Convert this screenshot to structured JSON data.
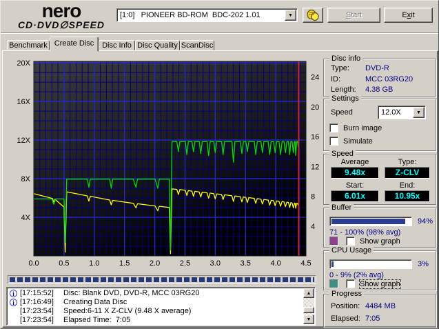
{
  "icons": {
    "info": "i",
    "dropdown": "▼",
    "scroll_up": "▲",
    "scroll_down": "▼"
  },
  "header": {
    "logo_top": "nero",
    "logo_bottom": "CD·DVD∅SPEED",
    "drive_selector": "[1:0]   PIONEER BD-ROM  BDC-202 1.01",
    "start_button": {
      "pre": "",
      "key": "S",
      "post": "tart"
    },
    "exit_button": {
      "pre": "E",
      "key": "x",
      "post": "it"
    }
  },
  "tabs": [
    {
      "label": "Benchmark"
    },
    {
      "label": "Create Disc"
    },
    {
      "label": "Disc Info"
    },
    {
      "label": "Disc Quality"
    },
    {
      "label": "ScanDisc"
    }
  ],
  "active_tab": "Create Disc",
  "disc_info": {
    "title": "Disc info",
    "rows": [
      {
        "label": "Type:",
        "value": "DVD-R"
      },
      {
        "label": "ID:",
        "value": "MCC 03RG20"
      },
      {
        "label": "Length:",
        "value": "4.38 GB"
      }
    ]
  },
  "settings": {
    "title": "Settings",
    "speed_label": "Speed",
    "speed_value": "12.0X",
    "checkboxes": [
      {
        "label": "Burn image",
        "checked": false
      },
      {
        "label": "Simulate",
        "checked": false
      }
    ]
  },
  "speed_panel": {
    "title": "Speed",
    "average_label": "Average",
    "average_value": "9.48x",
    "type_label": "Type:",
    "type_value": "Z-CLV",
    "start_label": "Start:",
    "start_value": "6.01x",
    "end_label": "End:",
    "end_value": "10.95x"
  },
  "buffer_panel": {
    "title": "Buffer",
    "percent": 94,
    "percent_label": "94%",
    "range_text": "71 - 100% (98% avg)",
    "swatch_color": "#8e3f8e",
    "show_graph_label": "Show graph",
    "checked": false
  },
  "cpu_panel": {
    "title": "CPU Usage",
    "percent": 3,
    "percent_label": "3%",
    "range_text": "0 - 9% (2% avg)",
    "swatch_color": "#3f8e85",
    "show_graph_label": "Show graph",
    "checked": false
  },
  "progress_panel": {
    "title": "Progress",
    "position_label": "Position:",
    "position_value": "4484 MB",
    "elapsed_label": "Elapsed:",
    "elapsed_value": "7:05"
  },
  "write_progress_percent": 100,
  "log": {
    "entries": [
      {
        "time": "[17:15:52]",
        "text": "Disc: Blank DVD, DVD-R, MCC 03RG20",
        "info_icon": true
      },
      {
        "time": "[17:16:49]",
        "text": "Creating Data Disc",
        "info_icon": true
      },
      {
        "time": "[17:23:54]",
        "text": "Speed:6-11 X Z-CLV (9.48 X average)",
        "info_icon": false
      },
      {
        "time": "[17:23:54]",
        "text": "Elapsed Time:  7:05",
        "info_icon": false
      }
    ]
  },
  "chart_data": {
    "type": "line",
    "title": "",
    "xlabel": "",
    "ylabel": "",
    "grid": true,
    "x_axis": {
      "min": 0,
      "max": 4.5,
      "minor_grid": 0.1,
      "major_grid": 0.5,
      "ticks": [
        {
          "v": 0,
          "label": "0.0"
        },
        {
          "v": 0.5,
          "label": "0.5"
        },
        {
          "v": 1,
          "label": "1.0"
        },
        {
          "v": 1.5,
          "label": "1.5"
        },
        {
          "v": 2,
          "label": "2.0"
        },
        {
          "v": 2.5,
          "label": "2.5"
        },
        {
          "v": 3,
          "label": "3.0"
        },
        {
          "v": 3.5,
          "label": "3.5"
        },
        {
          "v": 4,
          "label": "4.0"
        },
        {
          "v": 4.5,
          "label": "4.5"
        }
      ]
    },
    "left_axis": {
      "min": 0,
      "max": 20.15,
      "minor_grid": 1,
      "major_grid": 4,
      "ticks": [
        {
          "v": 4,
          "label": "4X"
        },
        {
          "v": 8,
          "label": "8X"
        },
        {
          "v": 12,
          "label": "12X"
        },
        {
          "v": 16,
          "label": "16X"
        },
        {
          "v": 20,
          "label": "20X"
        }
      ]
    },
    "right_axis": {
      "min": 0,
      "max": 26.1,
      "ticks": [
        {
          "v": 4,
          "label": "4"
        },
        {
          "v": 8,
          "label": "8"
        },
        {
          "v": 12,
          "label": "12"
        },
        {
          "v": 16,
          "label": "16"
        },
        {
          "v": 20,
          "label": "20"
        },
        {
          "v": 24,
          "label": "24"
        }
      ]
    },
    "end_marker": {
      "x": 4.38,
      "color": "#dd2222"
    },
    "colors": {
      "plot_bg_top": "#3c3c3c",
      "plot_bg_bottom": "#000000",
      "grid_major": "#2424d8",
      "grid_minor": "#000082"
    },
    "series": [
      {
        "name": "rotation-speed",
        "axis": "right",
        "color": "#ffff00",
        "points": [
          [
            0,
            8.35
          ],
          [
            0.31,
            7.7
          ],
          [
            0.33,
            7.15
          ],
          [
            0.35,
            7.6
          ],
          [
            0.5,
            6.55
          ],
          [
            0.52,
            0.5
          ],
          [
            0.545,
            8.6
          ],
          [
            0.885,
            8.05
          ],
          [
            0.91,
            7.35
          ],
          [
            0.935,
            8.0
          ],
          [
            1.255,
            7.5
          ],
          [
            1.28,
            6.85
          ],
          [
            1.305,
            7.45
          ],
          [
            1.645,
            7.05
          ],
          [
            1.69,
            6.45
          ],
          [
            1.715,
            7.0
          ],
          [
            2.005,
            6.7
          ],
          [
            2.05,
            6.05
          ],
          [
            2.075,
            6.65
          ],
          [
            2.24,
            6.5
          ],
          [
            2.26,
            0.3
          ],
          [
            2.285,
            9.0
          ],
          [
            2.365,
            8.92
          ],
          [
            2.39,
            8.25
          ],
          [
            2.415,
            8.9
          ],
          [
            2.505,
            8.79
          ],
          [
            2.53,
            8.1
          ],
          [
            2.555,
            8.77
          ],
          [
            2.615,
            8.68
          ],
          [
            2.64,
            8.0
          ],
          [
            2.665,
            8.66
          ],
          [
            2.735,
            8.57
          ],
          [
            2.76,
            7.9
          ],
          [
            2.785,
            8.55
          ],
          [
            2.865,
            8.45
          ],
          [
            2.89,
            7.75
          ],
          [
            2.915,
            8.43
          ],
          [
            2.975,
            8.34
          ],
          [
            3,
            7.65
          ],
          [
            3.025,
            8.32
          ],
          [
            3.105,
            8.22
          ],
          [
            3.13,
            7.55
          ],
          [
            3.155,
            8.2
          ],
          [
            3.275,
            8.06
          ],
          [
            3.3,
            7.3
          ],
          [
            3.325,
            8.04
          ],
          [
            3.415,
            7.93
          ],
          [
            3.44,
            7.25
          ],
          [
            3.465,
            7.91
          ],
          [
            3.505,
            7.84
          ],
          [
            3.53,
            7.15
          ],
          [
            3.555,
            7.82
          ],
          [
            3.645,
            7.71
          ],
          [
            3.67,
            7.05
          ],
          [
            3.695,
            7.69
          ],
          [
            3.755,
            7.6
          ],
          [
            3.78,
            6.95
          ],
          [
            3.805,
            7.58
          ],
          [
            3.875,
            7.49
          ],
          [
            3.9,
            6.8
          ],
          [
            3.925,
            7.47
          ],
          [
            3.965,
            7.4
          ],
          [
            3.99,
            6.75
          ],
          [
            4.015,
            7.38
          ],
          [
            4.055,
            7.32
          ],
          [
            4.08,
            6.65
          ],
          [
            4.105,
            7.3
          ],
          [
            4.135,
            7.24
          ],
          [
            4.16,
            6.6
          ],
          [
            4.185,
            7.22
          ],
          [
            4.21,
            7.17
          ],
          [
            4.23,
            6.5
          ],
          [
            4.25,
            7.15
          ],
          [
            4.27,
            7.11
          ],
          [
            4.29,
            6.45
          ],
          [
            4.31,
            7.09
          ],
          [
            4.32,
            7.07
          ],
          [
            4.33,
            6.4
          ],
          [
            4.345,
            7.05
          ],
          [
            4.36,
            7.03
          ],
          [
            4.38,
            6.6
          ]
        ]
      },
      {
        "name": "write-speed",
        "axis": "left",
        "color": "#00e000",
        "points": [
          [
            0,
            5.9
          ],
          [
            0.3,
            5.9
          ],
          [
            0.33,
            5.35
          ],
          [
            0.36,
            5.9
          ],
          [
            0.5,
            5.9
          ],
          [
            0.52,
            1.4
          ],
          [
            0.545,
            7.95
          ],
          [
            0.885,
            7.95
          ],
          [
            0.91,
            7.1
          ],
          [
            0.935,
            7.95
          ],
          [
            1.255,
            7.95
          ],
          [
            1.28,
            7.0
          ],
          [
            1.305,
            7.95
          ],
          [
            1.645,
            7.95
          ],
          [
            1.69,
            7.1
          ],
          [
            1.715,
            7.95
          ],
          [
            2.005,
            7.95
          ],
          [
            2.05,
            7.0
          ],
          [
            2.075,
            7.95
          ],
          [
            2.24,
            7.95
          ],
          [
            2.26,
            0.6
          ],
          [
            2.285,
            11.85
          ],
          [
            2.365,
            11.85
          ],
          [
            2.39,
            10.8
          ],
          [
            2.415,
            11.85
          ],
          [
            2.505,
            11.85
          ],
          [
            2.53,
            10.5
          ],
          [
            2.555,
            11.85
          ],
          [
            2.615,
            11.85
          ],
          [
            2.64,
            10.8
          ],
          [
            2.665,
            11.85
          ],
          [
            2.735,
            11.85
          ],
          [
            2.76,
            10.6
          ],
          [
            2.785,
            11.85
          ],
          [
            2.865,
            11.85
          ],
          [
            2.89,
            10.4
          ],
          [
            2.915,
            11.85
          ],
          [
            2.975,
            11.85
          ],
          [
            3,
            10.7
          ],
          [
            3.025,
            11.85
          ],
          [
            3.105,
            11.85
          ],
          [
            3.13,
            10.5
          ],
          [
            3.155,
            11.85
          ],
          [
            3.275,
            11.85
          ],
          [
            3.3,
            9.7
          ],
          [
            3.325,
            11.85
          ],
          [
            3.415,
            11.85
          ],
          [
            3.44,
            10.6
          ],
          [
            3.465,
            11.85
          ],
          [
            3.505,
            11.85
          ],
          [
            3.53,
            10.8
          ],
          [
            3.555,
            11.85
          ],
          [
            3.645,
            11.85
          ],
          [
            3.67,
            10.5
          ],
          [
            3.695,
            11.85
          ],
          [
            3.755,
            11.85
          ],
          [
            3.78,
            10.7
          ],
          [
            3.805,
            11.85
          ],
          [
            3.875,
            11.85
          ],
          [
            3.9,
            10.5
          ],
          [
            3.925,
            11.85
          ],
          [
            3.965,
            11.85
          ],
          [
            3.99,
            10.7
          ],
          [
            4.015,
            11.85
          ],
          [
            4.055,
            11.85
          ],
          [
            4.08,
            10.5
          ],
          [
            4.105,
            11.85
          ],
          [
            4.135,
            11.85
          ],
          [
            4.16,
            10.7
          ],
          [
            4.185,
            11.85
          ],
          [
            4.21,
            11.85
          ],
          [
            4.23,
            10.5
          ],
          [
            4.25,
            11.85
          ],
          [
            4.27,
            11.85
          ],
          [
            4.29,
            10.7
          ],
          [
            4.31,
            11.85
          ],
          [
            4.32,
            11.85
          ],
          [
            4.33,
            10.4
          ],
          [
            4.345,
            11.85
          ],
          [
            4.36,
            11.85
          ],
          [
            4.38,
            10.95
          ]
        ]
      }
    ]
  }
}
